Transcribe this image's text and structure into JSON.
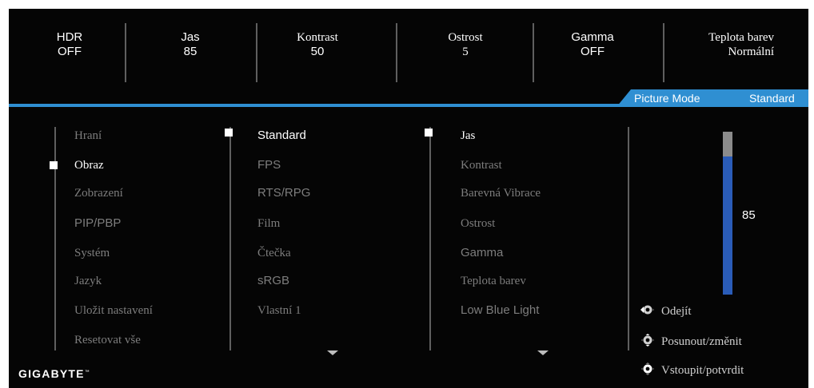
{
  "status_bar": [
    {
      "label": "HDR",
      "value": "OFF"
    },
    {
      "label": "Jas",
      "value": "85"
    },
    {
      "label": "Kontrast",
      "value": "50"
    },
    {
      "label": "Ostrost",
      "value": "5"
    },
    {
      "label": "Gamma",
      "value": "OFF"
    },
    {
      "label": "Teplota barev",
      "value": "Normální"
    }
  ],
  "mode_band": {
    "label": "Picture Mode",
    "value": "Standard"
  },
  "main_menu": {
    "items": [
      "Hraní",
      "Obraz",
      "Zobrazení",
      "PIP/PBP",
      "Systém",
      "Jazyk",
      "Uložit nastavení",
      "Resetovat vše"
    ],
    "selected": "Obraz"
  },
  "picture_modes": {
    "items": [
      "Standard",
      "FPS",
      "RTS/RPG",
      "Film",
      "Čtečka",
      "sRGB",
      "Vlastní 1"
    ],
    "selected": "Standard"
  },
  "adjustments": {
    "items": [
      "Jas",
      "Kontrast",
      "Barevná Vibrace",
      "Ostrost",
      "Gamma",
      "Teplota barev",
      "Low Blue Light"
    ],
    "selected": "Jas"
  },
  "slider": {
    "value": "85",
    "level": 0.85,
    "fill_color": "#2a5cb8",
    "rest_color": "#8b8b8b"
  },
  "hints": [
    {
      "icon": "joystick-left-icon",
      "label": "Odejít"
    },
    {
      "icon": "joystick-updown-icon",
      "label": "Posunout/změnit"
    },
    {
      "icon": "joystick-press-icon",
      "label": "Vstoupit/potvrdit"
    }
  ],
  "brand": {
    "logo": "GIGABYTE",
    "trademark": "™"
  },
  "colors": {
    "accent": "#2f8fd2",
    "background": "#050505",
    "inactive_text": "#7d7d7d"
  }
}
